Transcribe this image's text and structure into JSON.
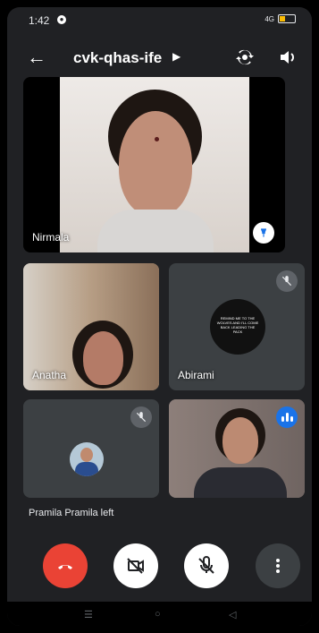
{
  "status_bar": {
    "time": "1:42",
    "network": "4G",
    "battery_color": "#fbbc04"
  },
  "meeting": {
    "code": "cvk-qhas-ife",
    "title_caret_icon": "caret-right-icon",
    "icons": [
      "back-arrow-icon",
      "camera-switch-icon",
      "speaker-icon"
    ]
  },
  "participants": {
    "main": {
      "name": "Nirmala",
      "pinned": true
    },
    "tiles": [
      {
        "name": "Anatha",
        "state": "video"
      },
      {
        "name": "Abirami",
        "state": "muted",
        "avatar_text": "REMIND ME TO THE WOLVES AND I'LL COME BACK LEADING THE PACK"
      },
      {
        "name": "",
        "state": "muted"
      },
      {
        "name": "",
        "state": "speaking"
      }
    ]
  },
  "notification": "Pramila Pramila left",
  "controls": {
    "end_call_color": "#ea4335",
    "camera_state": "off",
    "mic_state": "off",
    "more_icon": "more-vertical-icon"
  },
  "nav_bar": {
    "recent_icon": "recent-apps-icon",
    "home_icon": "home-icon",
    "back_icon": "back-triangle-icon"
  }
}
